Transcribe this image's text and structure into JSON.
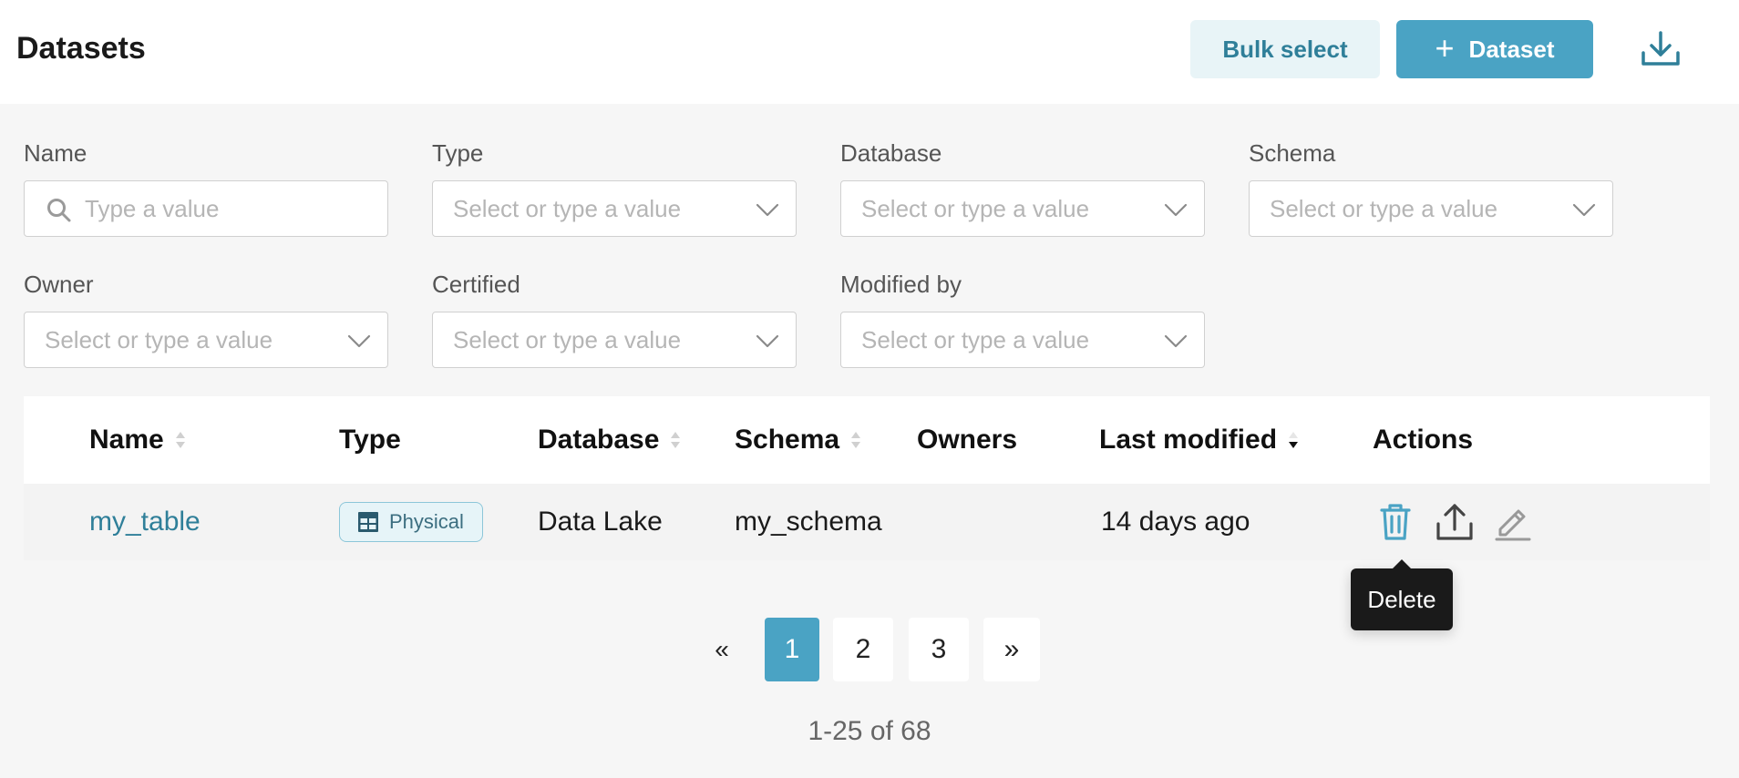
{
  "header": {
    "title": "Datasets",
    "bulk_select_label": "Bulk select",
    "add_dataset_plus": "+",
    "add_dataset_label": "Dataset",
    "download_icon": "download-icon"
  },
  "filters": [
    {
      "label": "Name",
      "placeholder": "Type a value",
      "kind": "search"
    },
    {
      "label": "Type",
      "placeholder": "Select or type a value",
      "kind": "select"
    },
    {
      "label": "Database",
      "placeholder": "Select or type a value",
      "kind": "select"
    },
    {
      "label": "Schema",
      "placeholder": "Select or type a value",
      "kind": "select"
    },
    {
      "label": "Owner",
      "placeholder": "Select or type a value",
      "kind": "select"
    },
    {
      "label": "Certified",
      "placeholder": "Select or type a value",
      "kind": "select"
    },
    {
      "label": "Modified by",
      "placeholder": "Select or type a value",
      "kind": "select"
    }
  ],
  "table": {
    "columns": [
      "Name",
      "Type",
      "Database",
      "Schema",
      "Owners",
      "Last modified",
      "Actions"
    ],
    "rows": [
      {
        "name": "my_table",
        "type": "Physical",
        "database": "Data Lake",
        "schema": "my_schema",
        "owners": "",
        "last_modified": "14 days ago"
      }
    ]
  },
  "tooltip": {
    "text": "Delete"
  },
  "pagination": {
    "prev": "«",
    "pages": [
      "1",
      "2",
      "3"
    ],
    "active_page": "1",
    "next": "»",
    "summary": "1-25 of 68"
  },
  "colors": {
    "accent": "#4aa3c4",
    "link": "#2f7f99",
    "bulk_bg": "#e8f4f7"
  }
}
